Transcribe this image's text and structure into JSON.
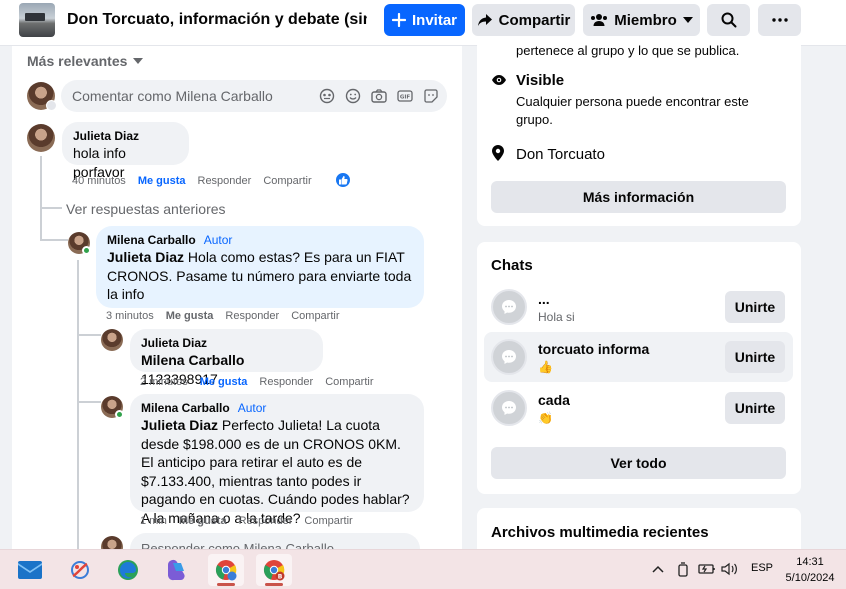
{
  "header": {
    "group_title": "Don Torcuato, información y debate (sin ...",
    "invite_label": "Invitar",
    "share_label": "Compartir",
    "member_label": "Miembro"
  },
  "comments": {
    "sort_label": "Más relevantes",
    "input_placeholder": "Comentar como Milena Carballo",
    "top_comment": {
      "author": "Julieta Diaz",
      "text": "hola info porfavor",
      "time": "40 minutos",
      "like": "Me gusta",
      "reply": "Responder",
      "share": "Compartir"
    },
    "view_previous": "Ver respuestas anteriores",
    "replies": [
      {
        "author": "Milena Carballo",
        "tag": "Autor",
        "mention": "Julieta Diaz",
        "text": " Hola como estas? Es para un FIAT CRONOS. Pasame tu número para enviarte toda la info",
        "time": "3 minutos",
        "like": "Me gusta",
        "reply": "Responder",
        "share": "Compartir"
      },
      {
        "author": "Julieta Diaz",
        "mention": "Milena Carballo",
        "text": " 1123398917",
        "time": "2 minutos",
        "like": "Me gusta",
        "reply": "Responder",
        "share": "Compartir"
      },
      {
        "author": "Milena Carballo",
        "tag": "Autor",
        "mention": "Julieta Diaz",
        "text": " Perfecto Julieta! La cuota desde $198.000 es de un CRONOS 0KM. El anticipo para retirar el auto es de $7.133.400, mientras tanto podes ir pagando en cuotas. Cuándo podes hablar? A la mañana o a la tarde?",
        "time": "1 min",
        "like": "Me gusta",
        "reply": "Responder",
        "share": "Compartir"
      }
    ],
    "reply_placeholder": "Responder como Milena Carballo"
  },
  "about": {
    "private_sub_tail": "pertenece al grupo y lo que se publica.",
    "visible_title": "Visible",
    "visible_sub": "Cualquier persona puede encontrar este grupo.",
    "location": "Don Torcuato",
    "more_info": "Más información"
  },
  "chats": {
    "title": "Chats",
    "items": [
      {
        "name": "...",
        "sub": "Hola si",
        "join": "Unirte"
      },
      {
        "name": "torcuato informa",
        "sub": "👍",
        "join": "Unirte"
      },
      {
        "name": "cada",
        "sub": "👏",
        "join": "Unirte"
      }
    ],
    "see_all": "Ver todo"
  },
  "media": {
    "title": "Archivos multimedia recientes"
  },
  "taskbar": {
    "language": "ESP",
    "time": "14:31",
    "date": "5/10/2024"
  },
  "colors": {
    "accent": "#0866ff",
    "author_bubble": "#e7f3ff",
    "taskbar": "#f3e4e6"
  }
}
